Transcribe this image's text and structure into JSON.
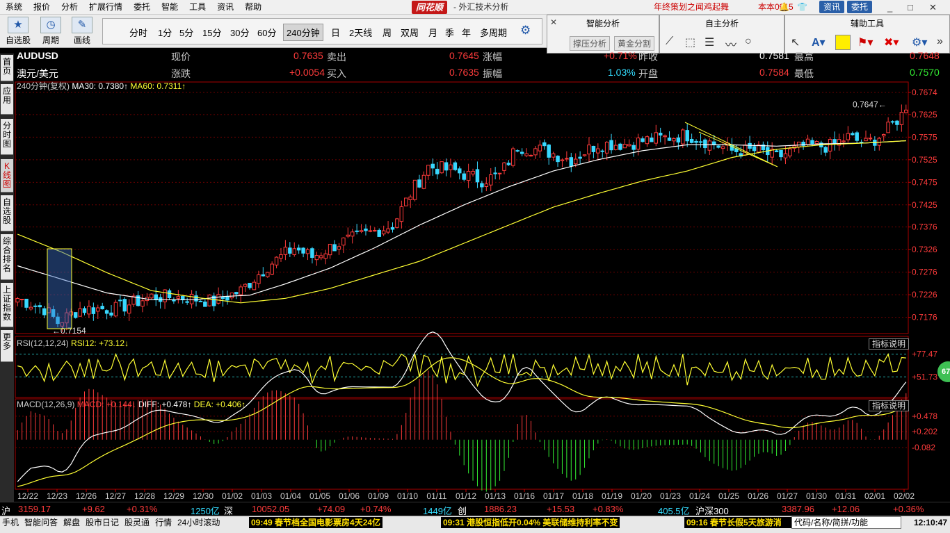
{
  "menu": {
    "items": [
      "系统",
      "报价",
      "分析",
      "扩展行情",
      "委托",
      "智能",
      "工具",
      "资讯",
      "帮助"
    ],
    "brand": "同花顺",
    "title": "- 外汇技术分析",
    "promo": "年终策划之闻鸡起舞",
    "version": "本本0915",
    "zixun": "资讯",
    "weituo": "委托",
    "minimize": "_",
    "restore": "□",
    "close": "✕"
  },
  "toolbar": {
    "zixuan": "自选股",
    "zhouqi": "周期",
    "huaxian": "画线"
  },
  "periods": {
    "items": [
      "分时",
      "1分",
      "5分",
      "15分",
      "30分",
      "60分",
      "240分钟",
      "日",
      "2天线",
      "周",
      "双周",
      "月",
      "季",
      "年",
      "多周期"
    ],
    "active": "240分钟"
  },
  "panels": {
    "smart": {
      "title": "智能分析",
      "b1": "撑压分析",
      "b2": "黄金分割"
    },
    "self": {
      "title": "自主分析"
    },
    "aux": {
      "title": "辅助工具"
    }
  },
  "sidebar": [
    "首页",
    "应用",
    "分时图",
    "K线图",
    "自选股",
    "综合排名",
    "上证指数",
    "更多"
  ],
  "quote": {
    "symbol": "AUDUSD",
    "name": "澳元/美元",
    "lbl_now": "现价",
    "now": "0.7635",
    "lbl_sell": "卖出",
    "sell": "0.7645",
    "lbl_rise": "涨幅",
    "rise": "+0.71%",
    "lbl_prev": "昨收",
    "prev": "0.7581",
    "lbl_high": "最高",
    "high": "0.7648",
    "lbl_chg": "涨跌",
    "chg": "+0.0054",
    "lbl_buy": "买入",
    "buy": "0.7635",
    "lbl_amp": "振幅",
    "amp": "1.03%",
    "lbl_open": "开盘",
    "open": "0.7584",
    "lbl_low": "最低",
    "low": "0.7570"
  },
  "legend": {
    "main_prefix": "240分钟(复权)",
    "ma30": "MA30: 0.7380",
    "ma60": "MA60: 0.7311",
    "rsi_prefix": "RSI(12,12,24)",
    "rsi12": "RSI12: +73.12",
    "macd_prefix": "MACD(12,26,9)",
    "macd": "MACD: +0.144",
    "diff": "DIFF: +0.478",
    "dea": "DEA: +0.406",
    "hint": "指标说明",
    "rsi_ball": "67"
  },
  "chart_data": {
    "type": "candlestick",
    "y_ticks": [
      "0.7674",
      "0.7625",
      "0.7575",
      "0.7525",
      "0.7475",
      "0.7425",
      "0.7376",
      "0.7326",
      "0.7276",
      "0.7226",
      "0.7176"
    ],
    "ylim": [
      0.714,
      0.7674
    ],
    "x_ticks": [
      "12/22",
      "12/23",
      "12/26",
      "12/27",
      "12/28",
      "12/29",
      "12/30",
      "01/02",
      "01/03",
      "01/04",
      "01/05",
      "01/06",
      "01/09",
      "01/10",
      "01/11",
      "01/12",
      "01/13",
      "01/16",
      "01/17",
      "01/18",
      "01/19",
      "01/20",
      "01/23",
      "01/24",
      "01/25",
      "01/26",
      "01/27",
      "01/30",
      "01/31",
      "02/01",
      "02/02"
    ],
    "annotations": {
      "high": "0.7647",
      "low": "0.7154"
    },
    "anchors": [
      [
        0,
        0.7218
      ],
      [
        6,
        0.7195
      ],
      [
        9,
        0.7165
      ],
      [
        14,
        0.7195
      ],
      [
        22,
        0.7195
      ],
      [
        30,
        0.7222
      ],
      [
        38,
        0.722
      ],
      [
        44,
        0.721
      ],
      [
        50,
        0.7235
      ],
      [
        56,
        0.729
      ],
      [
        62,
        0.733
      ],
      [
        66,
        0.731
      ],
      [
        72,
        0.734
      ],
      [
        78,
        0.736
      ],
      [
        84,
        0.738
      ],
      [
        88,
        0.745
      ],
      [
        92,
        0.751
      ],
      [
        98,
        0.75
      ],
      [
        104,
        0.748
      ],
      [
        108,
        0.749
      ],
      [
        112,
        0.7555
      ],
      [
        118,
        0.7545
      ],
      [
        124,
        0.7525
      ],
      [
        130,
        0.756
      ],
      [
        136,
        0.756
      ],
      [
        142,
        0.757
      ],
      [
        150,
        0.758
      ],
      [
        156,
        0.756
      ],
      [
        160,
        0.7545
      ],
      [
        166,
        0.7545
      ],
      [
        170,
        0.753
      ],
      [
        176,
        0.7555
      ],
      [
        182,
        0.7555
      ],
      [
        186,
        0.7575
      ],
      [
        190,
        0.756
      ],
      [
        194,
        0.7582
      ],
      [
        199,
        0.7635
      ]
    ],
    "ma30_anchors": [
      [
        0,
        0.729
      ],
      [
        10,
        0.726
      ],
      [
        20,
        0.723
      ],
      [
        30,
        0.7215
      ],
      [
        40,
        0.7215
      ],
      [
        46,
        0.7222
      ],
      [
        52,
        0.7225
      ],
      [
        60,
        0.725
      ],
      [
        70,
        0.7285
      ],
      [
        80,
        0.733
      ],
      [
        90,
        0.738
      ],
      [
        100,
        0.7425
      ],
      [
        110,
        0.7465
      ],
      [
        120,
        0.75
      ],
      [
        130,
        0.7525
      ],
      [
        140,
        0.7545
      ],
      [
        150,
        0.7558
      ],
      [
        160,
        0.7558
      ],
      [
        170,
        0.7555
      ],
      [
        180,
        0.756
      ],
      [
        190,
        0.7562
      ],
      [
        199,
        0.7567
      ]
    ],
    "ma60_anchors": [
      [
        0,
        0.736
      ],
      [
        10,
        0.732
      ],
      [
        20,
        0.7275
      ],
      [
        30,
        0.7235
      ],
      [
        40,
        0.722
      ],
      [
        50,
        0.7208
      ],
      [
        60,
        0.7218
      ],
      [
        70,
        0.724
      ],
      [
        80,
        0.727
      ],
      [
        90,
        0.73
      ],
      [
        100,
        0.734
      ],
      [
        110,
        0.738
      ],
      [
        120,
        0.742
      ],
      [
        130,
        0.745
      ],
      [
        140,
        0.7478
      ],
      [
        150,
        0.75
      ],
      [
        160,
        0.753
      ],
      [
        170,
        0.7548
      ],
      [
        180,
        0.7558
      ],
      [
        190,
        0.7562
      ],
      [
        199,
        0.7567
      ]
    ],
    "rsi": {
      "ticks": [
        "+77.47",
        "+51.73"
      ],
      "ylim": [
        30,
        85
      ],
      "line_high": 77.47,
      "line_low": 51.73
    },
    "macd": {
      "ticks": [
        "+0.478",
        "+0.202",
        "-0.082"
      ],
      "ylim": [
        -0.82,
        0.6
      ]
    }
  },
  "status": {
    "sh": "沪",
    "sh_val": "3159.17",
    "sh_chg": "+9.62",
    "sh_pct": "+0.31%",
    "sh_amt": "1250亿",
    "sz": "深",
    "sz_val": "10052.05",
    "sz_chg": "+74.09",
    "sz_pct": "+0.74%",
    "cy_amt": "1449亿",
    "cy": "创",
    "cy_val": "1886.23",
    "cy_chg": "+15.53",
    "cy_pct": "+0.83%",
    "hs_amt": "405.5亿",
    "hs": "沪深300",
    "hs_val": "3387.96",
    "hs_chg": "+12.06",
    "hs_pct": "+0.36%"
  },
  "bottom": {
    "items": [
      "手机",
      "智能问答",
      "解盘",
      "股市日记",
      "股灵通",
      "行情",
      "24小时滚动"
    ],
    "news1": "09:49 春节档全国电影票房4天24亿",
    "news2": "09:31 港股恒指低开0.04% 美联储维持利率不变",
    "news3": "09:16 春节长假5天旅游消",
    "search": "代码/名称/简拼/功能",
    "clock": "12:10:47"
  }
}
